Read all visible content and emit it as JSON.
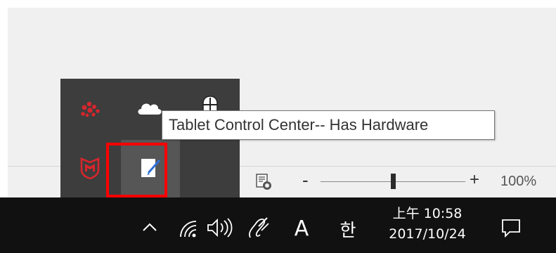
{
  "tooltip": {
    "text": "Tablet Control Center-- Has Hardware"
  },
  "tray_flyout": {
    "icons": [
      "red-cluster-app-icon",
      "onedrive-cloud-icon",
      "network-shield-icon",
      "mcafee-shield-icon",
      "tablet-control-center-icon"
    ]
  },
  "statusbar": {
    "zoom_minus": "-",
    "zoom_plus": "+",
    "zoom_level": "100%",
    "zoom_fraction": 0.5
  },
  "taskbar": {
    "show_hidden_icons": "^",
    "ime_letter": "A",
    "ime_korean": "한",
    "clock_time": "上午 10:58",
    "clock_date": "2017/10/24"
  },
  "colors": {
    "taskbar": "#111111",
    "flyout": "#3d3d3d",
    "highlight": "#ff0000",
    "mcafee_red": "#d6262c"
  }
}
